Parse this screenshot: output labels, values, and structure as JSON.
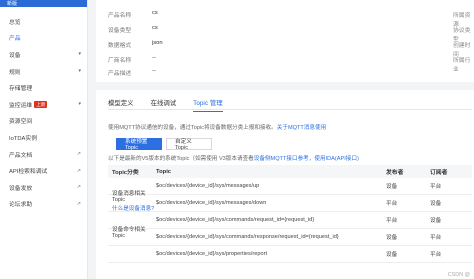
{
  "sidebar": {
    "top_label": "新版",
    "items": [
      {
        "label": "总览",
        "chevron": false,
        "active": false
      },
      {
        "label": "产品",
        "chevron": false,
        "active": true
      },
      {
        "label": "设备",
        "chevron": true,
        "active": false
      },
      {
        "label": "规则",
        "chevron": true,
        "active": false
      },
      {
        "label": "存储管理",
        "chevron": false,
        "active": false
      },
      {
        "label": "监控运维",
        "chevron": true,
        "active": false,
        "badge": "上新"
      },
      {
        "label": "资源空间",
        "chevron": false,
        "active": false
      },
      {
        "label": "IoTDA实例",
        "chevron": false,
        "active": false
      },
      {
        "label": "产品文档",
        "chevron": false,
        "active": false
      },
      {
        "label": "API检索和调试",
        "chevron": false,
        "active": false
      },
      {
        "label": "设备发放",
        "chevron": false,
        "active": false
      },
      {
        "label": "论坛求助",
        "chevron": false,
        "active": false
      }
    ]
  },
  "product_info": {
    "rows": [
      {
        "key": "产品名称",
        "value": "cs"
      },
      {
        "key": "设备类型",
        "value": "cs"
      },
      {
        "key": "数据格式",
        "value": "json"
      },
      {
        "key": "厂商名称",
        "value": "--"
      },
      {
        "key": "产品描述",
        "value": "--"
      }
    ],
    "right_labels": [
      "所属资源",
      "协议类型",
      "创建时间",
      "所属行业"
    ]
  },
  "tabs": [
    "模型定义",
    "在线调试",
    "Topic 管理"
  ],
  "active_tab": "Topic 管理",
  "description": "使用MQTT协议通信的设备，通过Topic将设备数据分类上报和接收。",
  "description_link": "关于MQTT消息使用",
  "buttons": {
    "system": "系统预置Topic",
    "custom": "自定义Topic"
  },
  "note": "以下是最新的V5版本的系统Topic（如需使用 V3版本请查看",
  "note_link": "设备侧MQTT接口参考，使用IDA(API接口)",
  "table": {
    "headers": [
      "Topic分类",
      "Topic",
      "发布者",
      "订阅者"
    ],
    "group1": {
      "label": "设备消息相关Topic",
      "link": "什么是设备消息?"
    },
    "group2": {
      "label": "设备命令相关Topic"
    },
    "rows": [
      {
        "topic": "$oc/devices/{device_id}/sys/messages/up",
        "publisher": "设备",
        "subscriber": "平台"
      },
      {
        "topic": "$oc/devices/{device_id}/sys/messages/down",
        "publisher": "平台",
        "subscriber": "设备"
      },
      {
        "topic": "$oc/devices/{device_id}/sys/commands/request_id={request_id}",
        "publisher": "平台",
        "subscriber": "设备"
      },
      {
        "topic": "$oc/devices/{device_id}/sys/commands/response/request_id={request_id}",
        "publisher": "设备",
        "subscriber": "平台"
      },
      {
        "topic": "$oc/devices/{device_id}/sys/properties/report",
        "publisher": "设备",
        "subscriber": "平台"
      }
    ]
  },
  "watermark": "CSDN @"
}
